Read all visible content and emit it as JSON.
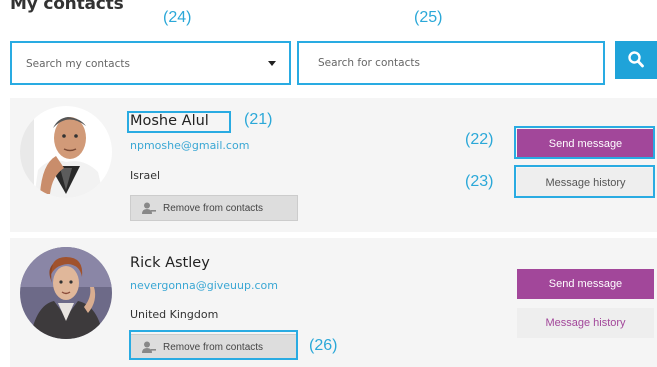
{
  "page": {
    "title": "My contacts"
  },
  "search": {
    "my_contacts_placeholder": "Search my contacts",
    "global_placeholder": "Search for contacts"
  },
  "annotations": {
    "a21": "(21)",
    "a22": "(22)",
    "a23": "(23)",
    "a24": "(24)",
    "a25": "(25)",
    "a26": "(26)"
  },
  "contacts": [
    {
      "name": "Moshe Alul",
      "email": "npmoshe@gmail.com",
      "country": "Israel",
      "remove_label": "Remove from contacts",
      "send_label": "Send message",
      "history_label": "Message history"
    },
    {
      "name": "Rick Astley",
      "email": "nevergonna@giveuup.com",
      "country": "United Kingdom",
      "remove_label": "Remove from contacts",
      "send_label": "Send message",
      "history_label": "Message history"
    }
  ],
  "colors": {
    "accent_blue": "#1fa3d9",
    "brand_purple": "#a2479a",
    "annotation_blue": "#29abe2",
    "link_blue": "#3aa7d4"
  },
  "icons": {
    "search": "search-icon",
    "remove": "remove-user-icon",
    "dropdown": "chevron-down-icon"
  }
}
